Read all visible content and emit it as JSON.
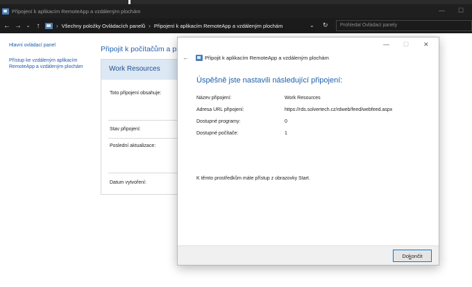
{
  "window": {
    "title": "Připojení k aplikacím RemoteApp a vzdáleným plochám",
    "minimize_glyph": "—",
    "maximize_glyph": "☐"
  },
  "address": {
    "back_glyph": "←",
    "forward_glyph": "→",
    "recent_glyph": "⌄",
    "up_glyph": "↑",
    "sep_glyph": "›",
    "crumbs": [
      "Všechny položky Ovládacích panelů",
      "Připojení k aplikacím RemoteApp a vzdáleným plochám"
    ],
    "dropdown_glyph": "⌄",
    "refresh_glyph": "↻",
    "search_placeholder": "Prohledat Ovládací panely"
  },
  "left_nav": {
    "home": "Hlavní ovládací panel",
    "access": "Přístup ke vzdáleným aplikacím RemoteApp a vzdáleným plochám"
  },
  "main": {
    "title": "Připojit k počítačům a programům",
    "card": {
      "name": "Work Resources",
      "contains_label": "Toto připojení obsahuje:",
      "status_label": "Stav připojení:",
      "last_update_label": "Poslední aktualizace:",
      "created_label": "Datum vytvoření:"
    }
  },
  "dialog": {
    "title": "Připojit k aplikacím RemoteApp a vzdáleným plochám",
    "back_glyph": "←",
    "minimize_glyph": "—",
    "maximize_glyph": "☐",
    "close_glyph": "✕",
    "heading": "Úspěšně jste nastavili následující připojení:",
    "fields": [
      {
        "label": "Název připojení:",
        "value": "Work Resources"
      },
      {
        "label": "Adresa URL připojení:",
        "value": "https://rds.solvertech.cz/rdweb/feed/webfeed.aspx"
      },
      {
        "label": "Dostupné programy:",
        "value": "0"
      },
      {
        "label": "Dostupné počítače:",
        "value": "1"
      }
    ],
    "note": "K těmto prostředkům máte přístup z obrazovky Start.",
    "finish": {
      "pre": "Do",
      "underlined": "k",
      "post": "ončit"
    }
  }
}
